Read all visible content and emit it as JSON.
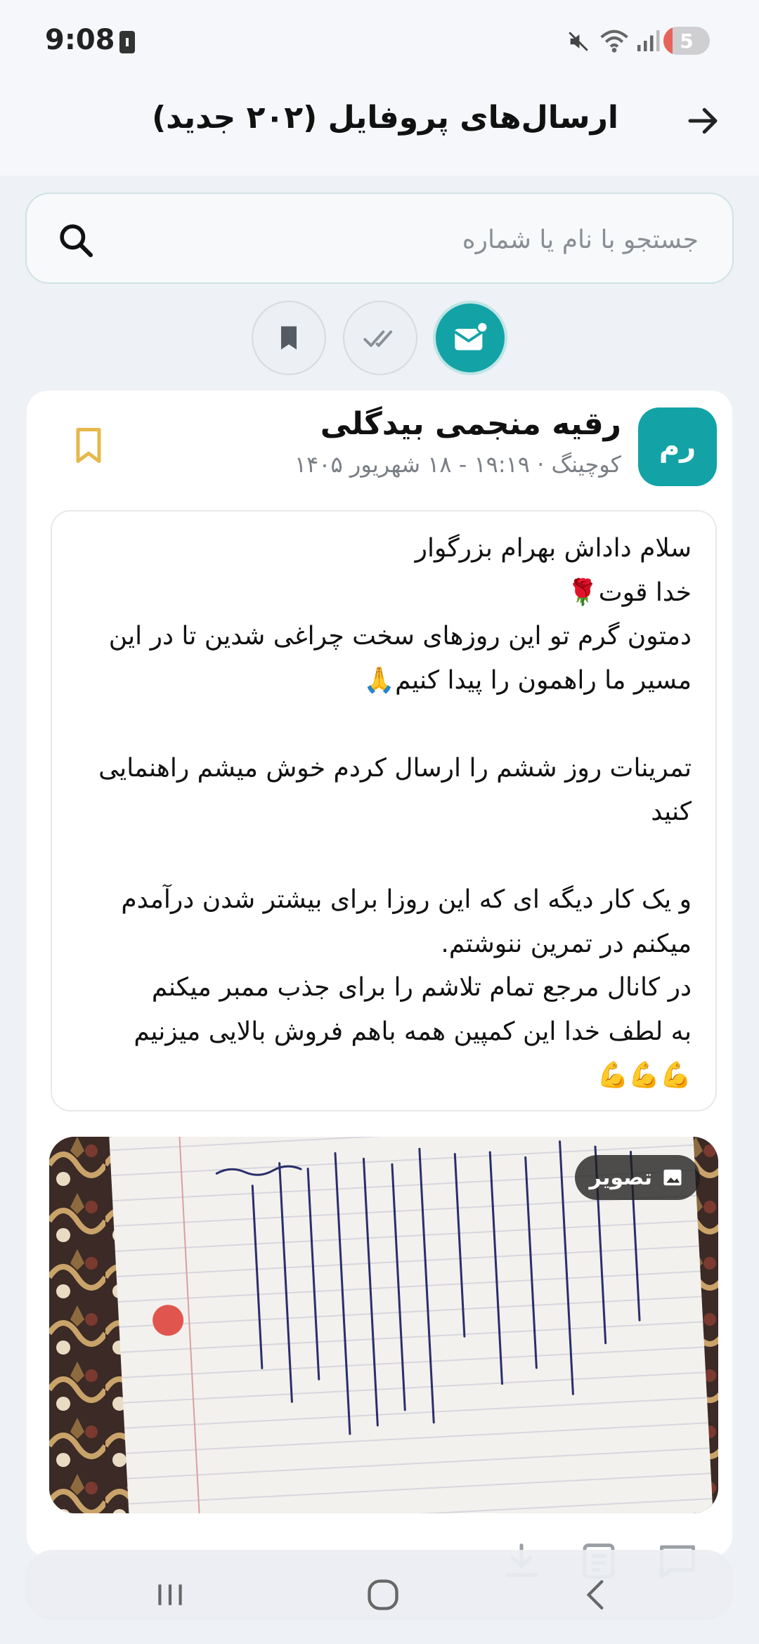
{
  "status_bar": {
    "time": "9:08",
    "battery_level": "5",
    "battery_fraction": 0.05,
    "wifi_label": "5"
  },
  "header": {
    "title": "ارسال‌های پروفایل (۲۰۲ جدید)"
  },
  "search": {
    "placeholder": "جستجو با نام یا شماره"
  },
  "filters": [
    {
      "icon": "mail-unread-icon",
      "active": true
    },
    {
      "icon": "double-check-icon",
      "active": false
    },
    {
      "icon": "bookmark-icon",
      "active": false
    }
  ],
  "message_card": {
    "avatar_initials": "رم",
    "sender_name": "رقیه منجمی بیدگلی",
    "meta": "کوچینگ · ۱۹:۱۹ - ۱۸ شهریور ۱۴۰۵",
    "body": "سلام داداش بهرام بزرگوار\nخدا قوت🌹\nدمتون گرم تو این روزهای سخت چراغی شدین تا در این مسیر ما راهمون را پیدا کنیم🙏\n\nتمرینات روز ششم را ارسال کردم خوش میشم راهنمایی کنید\n\nو یک کار دیگه ای که این روزا برای بیشتر شدن درآمدم میکنم در تمرین ننوشتم.\nدر کانال مرجع تمام تلاشم را برای جذب ممبر میکنم\nبه لطف خدا این کمپین همه باهم فروش بالایی میزنیم\n💪💪💪",
    "attachment_label": "تصویر"
  },
  "colors": {
    "accent": "#13a3a6",
    "bookmark": "#e6b84a",
    "background": "#eef1f5"
  }
}
